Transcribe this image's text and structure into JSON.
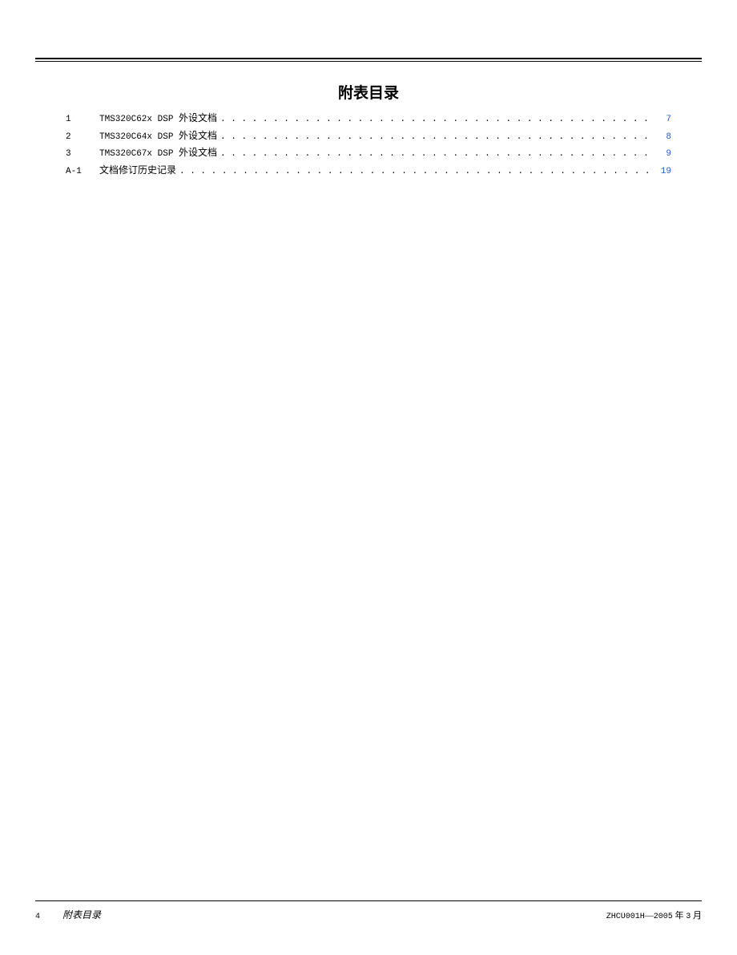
{
  "title": "附表目录",
  "toc": [
    {
      "num": "1",
      "code": "TMS320C62x DSP ",
      "label": "外设文档",
      "page": "7"
    },
    {
      "num": "2",
      "code": "TMS320C64x DSP ",
      "label": "外设文档",
      "page": "8"
    },
    {
      "num": "3",
      "code": "TMS320C67x DSP ",
      "label": "外设文档",
      "page": "9"
    },
    {
      "num": "A-1",
      "code": "",
      "label": "文档修订历史记录",
      "page": "19"
    }
  ],
  "footer": {
    "pagenum": "4",
    "title": "附表目录",
    "docid": "ZHCU001H",
    "sep": "—",
    "date_year": "2005",
    "date_suffix1": " 年 ",
    "date_month": "3",
    "date_suffix2": " 月"
  }
}
